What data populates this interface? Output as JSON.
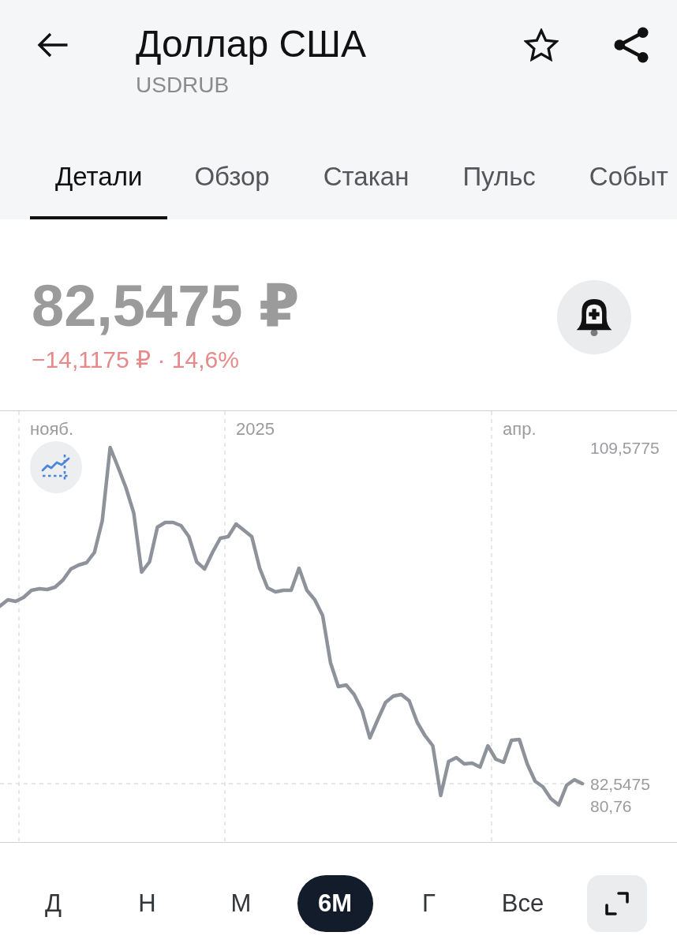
{
  "header": {
    "title": "Доллар США",
    "ticker": "USDRUB",
    "favorite": false
  },
  "tabs": [
    {
      "label": "Детали",
      "selected": true
    },
    {
      "label": "Обзор",
      "selected": false
    },
    {
      "label": "Стакан",
      "selected": false
    },
    {
      "label": "Пульс",
      "selected": false
    },
    {
      "label": "Событ",
      "selected": false
    }
  ],
  "quote": {
    "price": "82,5475 ₽",
    "change": "−14,1175 ₽ · 14,6%"
  },
  "chart": {
    "date_labels": [
      "нояб.",
      "2025",
      "апр."
    ],
    "price_labels": [
      "109,5775",
      "82,5475",
      "80,76"
    ]
  },
  "periods": [
    {
      "label": "Д",
      "selected": false
    },
    {
      "label": "Н",
      "selected": false
    },
    {
      "label": "М",
      "selected": false
    },
    {
      "label": "6М",
      "selected": true
    },
    {
      "label": "Г",
      "selected": false
    },
    {
      "label": "Все",
      "selected": false
    }
  ]
}
